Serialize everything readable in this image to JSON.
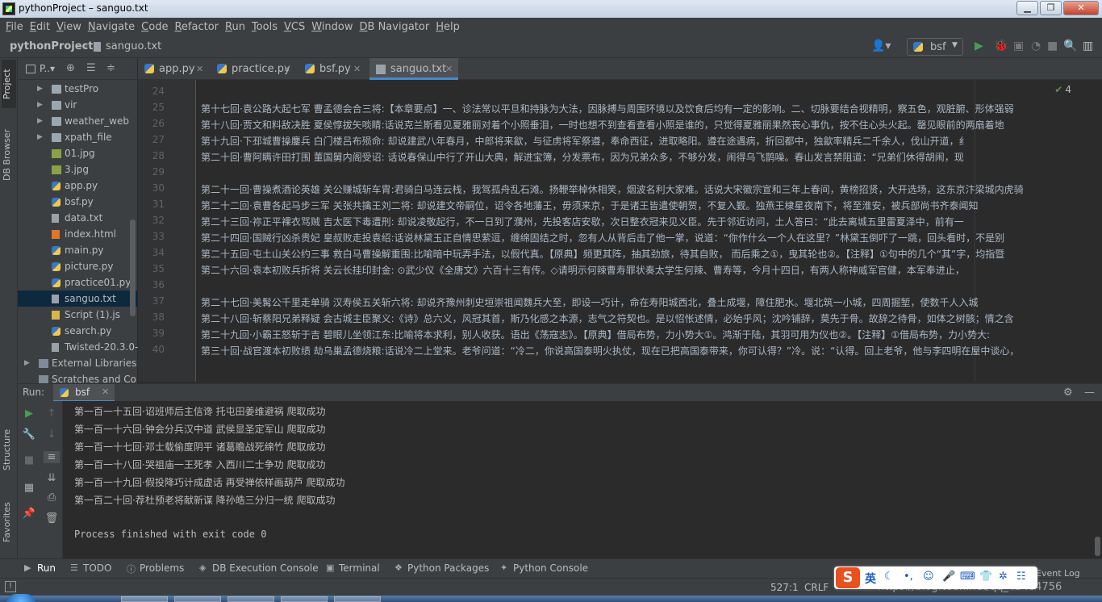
{
  "window": {
    "title": "pythonProject – sanguo.txt",
    "minimize": "▁",
    "maximize": "❐",
    "close": "✕"
  },
  "menu": [
    "File",
    "Edit",
    "View",
    "Navigate",
    "Code",
    "Refactor",
    "Run",
    "Tools",
    "VCS",
    "Window",
    "DB Navigator",
    "Help"
  ],
  "navbar": {
    "project": "pythonProject",
    "separator": "›",
    "file": "sanguo.txt",
    "run_config": "bsf"
  },
  "project_panel": {
    "title": "P..▾",
    "items": [
      {
        "label": "testPro",
        "type": "folder",
        "expandable": true
      },
      {
        "label": "vir",
        "type": "folder",
        "expandable": true
      },
      {
        "label": "weather_web",
        "type": "folder",
        "expandable": true
      },
      {
        "label": "xpath_file",
        "type": "folder",
        "expandable": true
      },
      {
        "label": "01.jpg",
        "type": "img"
      },
      {
        "label": "3.jpg",
        "type": "img"
      },
      {
        "label": "app.py",
        "type": "py"
      },
      {
        "label": "bsf.py",
        "type": "py"
      },
      {
        "label": "data.txt",
        "type": "txt"
      },
      {
        "label": "index.html",
        "type": "html"
      },
      {
        "label": "main.py",
        "type": "py"
      },
      {
        "label": "picture.py",
        "type": "py"
      },
      {
        "label": "practice01.py",
        "type": "py"
      },
      {
        "label": "sanguo.txt",
        "type": "txt",
        "selected": true
      },
      {
        "label": "Script (1).js",
        "type": "js"
      },
      {
        "label": "search.py",
        "type": "py"
      },
      {
        "label": "Twisted-20.3.0-",
        "type": "txt"
      },
      {
        "label": "External Libraries",
        "type": "lib",
        "expandable": true,
        "root": true
      },
      {
        "label": "Scratches and Co",
        "type": "lib",
        "root": true
      }
    ]
  },
  "editor_tabs": [
    {
      "label": "app.py",
      "type": "py"
    },
    {
      "label": "practice.py",
      "type": "py"
    },
    {
      "label": "bsf.py",
      "type": "py"
    },
    {
      "label": "sanguo.txt",
      "type": "txt",
      "active": true
    }
  ],
  "editor": {
    "inspection_count": "4",
    "lines": [
      {
        "num": "24",
        "text": ""
      },
      {
        "num": "25",
        "text": "第十七回·袁公路大起七军      曹孟德会合三将:【本章要点】一、诊法常以平旦和持脉为大法，因脉搏与周围环境以及饮食后均有一定的影响。二、切脉要结合视精明，察五色，观脏腑、形体强弱"
      },
      {
        "num": "26",
        "text": "第十八回·贾文和料敌决胜      夏侯惇拔矢啖睛:话说克兰斯看见夏雅丽对着个小照垂泪，一时也想不到查看查看小照是谁的，只觉得夏雅丽果然丧心事仇，按不住心头火起。罄见眼前的两扇着地"
      },
      {
        "num": "27",
        "text": "第十九回·下邳城曹操鏖兵      白门楼吕布殒命:            却说建武八年春月，中郎将来歙，与征虏将军祭遵，奉命西征，进取略阳。遵在途遇病，折回都中，独歙率精兵二千余人，伐山开道，纟"
      },
      {
        "num": "28",
        "text": "第二十回·曹阿瞒许田打围      董国舅内阁受诏:            话说春保山中行了开山大典，解进宝簿，分发票布，因为兄弟众多，不够分发，闹得乌飞鹊噪。春山发言禁阻道：“兄弟们休得胡闹，现"
      },
      {
        "num": "29",
        "text": ""
      },
      {
        "num": "30",
        "text": "第二十一回·曹操煮酒论英雄    关公赚城斩车胄:君骑白马连云栈，我驾孤舟乱石滩。扬鞭举棹休相笑，烟波名利大家难。话说大宋徽宗宣和三年上春间，黄榜招贤，大开选场，这东京汴梁城内虎骑"
      },
      {
        "num": "31",
        "text": "第二十二回·袁曹各起马步三军   关张共擒王刘二将:            却说建文帝嗣位，诏令各地藩王，毋须来京，于是诸王皆遣使朝贺，不复入觐。独燕王棣星夜南下，将至淮安，被兵部尚书齐泰闻知"
      },
      {
        "num": "32",
        "text": "第二十三回·祢正平裸衣骂贼     吉太医下毒遭刑:            却说凌敬起行，不一日到了濮州，先投客店安歇，次日整衣冠来见义臣。先于邻近访问，土人答曰：“此去离城五里雷夏泽中，前有一"
      },
      {
        "num": "33",
        "text": "第二十四回·国贼行凶杀贵妃     皇叔败走投袁绍:话说林黛玉正自情思萦逗，缠绵固结之时，忽有人从背后击了他一掌，说道：“你作什么一个人在这里？”林黛玉倒吓了一跳，回头看时，不是别"
      },
      {
        "num": "34",
        "text": "第二十五回·屯土山关公约三事    救白马曹操解重围:比喻暗中玩弄手法，以假代真。【原典】频更其阵，抽其劲旅，待其自败，  而后乘之①，曳其轮也②。【注释】①句中的几个“其”字，均指暨"
      },
      {
        "num": "35",
        "text": "第二十六回·袁本初败兵折将      关云长挂印封金:            ⊙武少仪《全唐文》六百十三有传。◇请明示何辣曹寿罪状奏太学生何辣、曹寿等，今月十四日，有两人称神威军官健，本军奉进止，"
      },
      {
        "num": "36",
        "text": ""
      },
      {
        "num": "37",
        "text": "第二十七回·美髯公千里走单骑    汉寿侯五关斩六将:            却说齐豫州刺史垣崇祖闻魏兵大至，即设一巧计，命在寿阳城西北，叠土成堰，障住肥水。堰北筑一小城，四周掘堑，使数千人入城"
      },
      {
        "num": "38",
        "text": "第二十八回·斩蔡阳兄弟释疑      会古城主臣聚义:《诗》总六义，风冠其首，斯乃化感之本源，志气之符契也。是以怊怅述情，必始乎风；沈吟铺辞，莫先于骨。故辞之待骨，如体之树骸；情之含"
      },
      {
        "num": "39",
        "text": "第二十九回·小霸王怒斩于吉      碧眼儿坐领江东:比喻将本求利，别人收获。语出《荡寇志》。【原典】借局布势，力小势大①。鸿渐于陆，其羽可用为仪也②。【注释】①借局布势，力小势大:"
      },
      {
        "num": "40",
        "text": "第三十回·战官渡本初败绩    劫乌巢孟德烧粮:话说冷二上堂来。老爷问道：“冷二，你说高国泰明火执仗，现在已把高国泰带来，你可认得？”冷。说：“认得。回上老爷，他与李四明在屋中谈心，"
      }
    ]
  },
  "run": {
    "label": "Run:",
    "tab": "bsf",
    "output": [
      "第一百一十五回·诏班师后主信谗      托屯田姜维避祸  爬取成功",
      "第一百一十六回·钟会分兵汉中道      武侯显圣定军山  爬取成功",
      "第一百一十七回·邓士载偷度阴平      诸葛瞻战死绵竹  爬取成功",
      "第一百一十八回·哭祖庙一王死孝      入西川二士争功  爬取成功",
      "第一百一十九回·假投降巧计成虚话    再受禅依样画葫芦  爬取成功",
      "第一百二十回·荐杜预老将献新谋    降孙皓三分归一统  爬取成功",
      "",
      "Process finished with exit code 0"
    ]
  },
  "toolwindows": [
    "Run",
    "TODO",
    "Problems",
    "DB Execution Console",
    "Terminal",
    "Python Packages",
    "Python Console"
  ],
  "left_stripe": {
    "project": "Project",
    "db_browser": "DB Browser",
    "structure": "Structure",
    "favorites": "Favorites"
  },
  "status": {
    "position": "527:1",
    "line_sep": "CRLF",
    "event_log": "Event Log",
    "watermark": "https://blog.csdn.net/qq_45484756"
  },
  "ime": {
    "lang": "英"
  }
}
